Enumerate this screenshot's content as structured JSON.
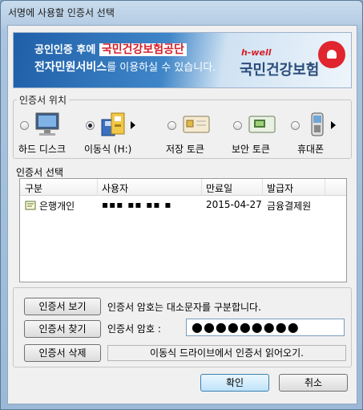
{
  "window": {
    "title": "서명에 사용할 인증서 선택"
  },
  "banner": {
    "line1_prefix": "공인인증 후에",
    "line1_highlight": "국민건강보험공단",
    "line2_bold": "전자민원서비스",
    "line2_rest": "를 이용하실 수 있습니다.",
    "brand_tag": "h-well",
    "org_name": "국민건강보험"
  },
  "location": {
    "label": "인증서 위치",
    "items": [
      {
        "label": "하드 디스크",
        "icon": "monitor-icon",
        "selected": false
      },
      {
        "label": "이동식 (H:)",
        "icon": "removable-drive-icon",
        "selected": true
      },
      {
        "label": "저장 토큰",
        "icon": "storage-token-icon",
        "selected": false
      },
      {
        "label": "보안 토큰",
        "icon": "security-token-icon",
        "selected": false
      },
      {
        "label": "휴대폰",
        "icon": "mobile-phone-icon",
        "selected": false
      }
    ]
  },
  "cert_select": {
    "label": "인증서 선택",
    "columns": [
      "구분",
      "사용자",
      "만료일",
      "발급자"
    ],
    "rows": [
      {
        "type": "은행개인",
        "user": "▪▪▪ ▪▪ ▪▪ ▪",
        "expiry": "2015-04-27",
        "issuer": "금융결제원"
      }
    ]
  },
  "actions": {
    "view_label": "인증서 보기",
    "find_label": "인증서 찾기",
    "delete_label": "인증서 삭제",
    "case_notice": "인증서 암호는 대소문자를 구분합니다.",
    "password_label": "인증서 암호 :",
    "password_mask": "●●●●●●●●●",
    "status_text": "이동식 드라이브에서 인증서 읽어오기."
  },
  "footer": {
    "ok_label": "확인",
    "cancel_label": "취소"
  }
}
